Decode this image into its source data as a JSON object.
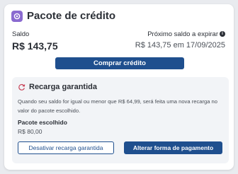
{
  "header": {
    "title": "Pacote de crédito",
    "icon": "wallet-icon"
  },
  "balance": {
    "label": "Saldo",
    "value": "R$ 143,75"
  },
  "next_balance": {
    "label": "Próximo saldo a expirar",
    "value": "R$ 143,75 em 17/09/2025",
    "info_icon": "i"
  },
  "actions": {
    "buy_credit": "Comprar crédito"
  },
  "recharge": {
    "title": "Recarga garantida",
    "icon": "refresh-icon",
    "description": "Quando seu saldo for igual ou menor que R$ 64,99, será feita uma nova recarga no valor do pacote escolhido.",
    "package_label": "Pacote escolhido",
    "package_value": "R$ 80,00",
    "disable_button": "Desativar recarga garantida",
    "change_payment_button": "Alterar forma de pagamento"
  },
  "colors": {
    "primary": "#1f4f8e",
    "accent_icon": "#8a6ad0",
    "background": "#e9ebef",
    "panel": "#f2f4f7"
  }
}
